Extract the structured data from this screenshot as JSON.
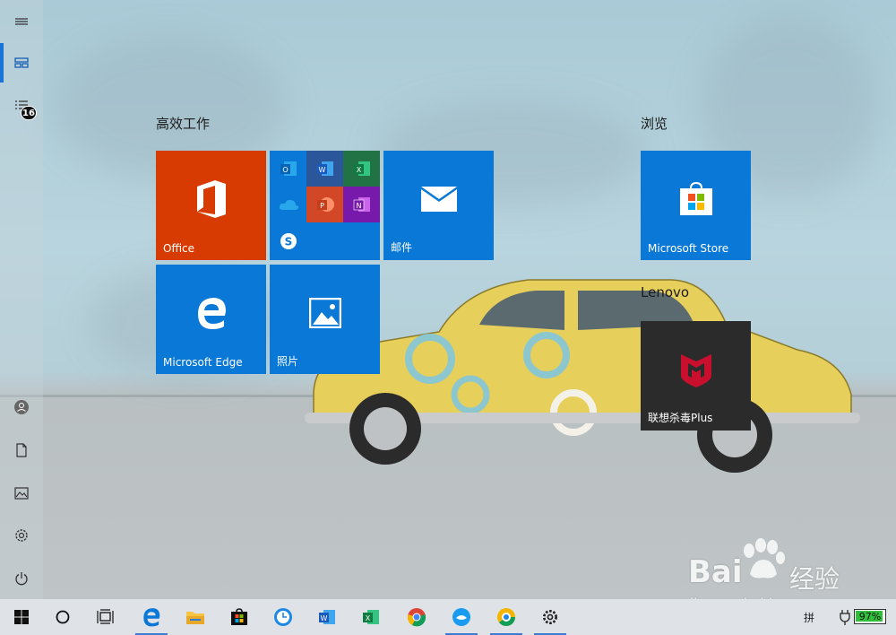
{
  "groups": {
    "productivity": "高效工作",
    "browse": "浏览",
    "lenovo": "Lenovo"
  },
  "tiles": {
    "office": {
      "label": "Office",
      "color": "#d83b01"
    },
    "mail": {
      "label": "邮件",
      "color": "#0a78d7"
    },
    "edge": {
      "label": "Microsoft Edge",
      "color": "#0a78d7"
    },
    "photos": {
      "label": "照片",
      "color": "#0a78d7"
    },
    "store": {
      "label": "Microsoft Store",
      "color": "#0a78d7"
    },
    "mcafee": {
      "label": "联想杀毒Plus",
      "color": "#2b2b2b"
    }
  },
  "office_apps": [
    {
      "name": "outlook-icon",
      "letter": "O",
      "color": "#0a64b6"
    },
    {
      "name": "word-icon",
      "letter": "W",
      "color": "#2b579a"
    },
    {
      "name": "excel-icon",
      "letter": "X",
      "color": "#217346"
    },
    {
      "name": "onedrive-icon",
      "letter": "",
      "color": "#0a78d7"
    },
    {
      "name": "powerpoint-icon",
      "letter": "P",
      "color": "#d24726"
    },
    {
      "name": "onenote-icon",
      "letter": "N",
      "color": "#7719aa"
    },
    {
      "name": "skype-icon",
      "letter": "S",
      "color": "#0a78d7"
    }
  ],
  "rail": {
    "badge_count": "16"
  },
  "taskbar": {
    "ime_label": "拼",
    "battery_percent": 97,
    "battery_label": "97%"
  },
  "watermark": {
    "brand": "Bai",
    "brand2": "经验",
    "url": "jingyan.baidu.com"
  },
  "colors": {
    "accent": "#0a78d7",
    "office": "#d83b01",
    "taskbar": "#dfe3e8"
  }
}
